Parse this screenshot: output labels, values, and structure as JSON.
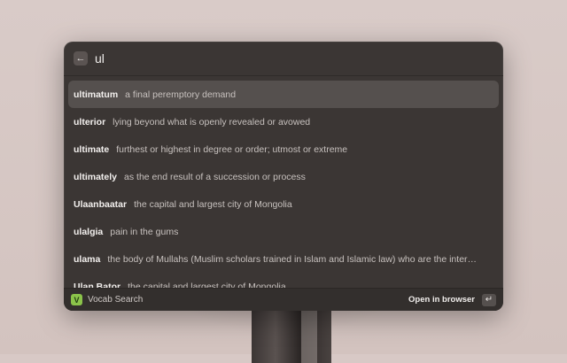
{
  "search": {
    "query": "ul",
    "back_icon": "←"
  },
  "results": [
    {
      "term": "ultimatum",
      "definition": "a final peremptory demand",
      "selected": true
    },
    {
      "term": "ulterior",
      "definition": "lying beyond what is openly revealed or avowed"
    },
    {
      "term": "ultimate",
      "definition": "furthest or highest in degree or order; utmost or extreme"
    },
    {
      "term": "ultimately",
      "definition": "as the end result of a succession or process"
    },
    {
      "term": "Ulaanbaatar",
      "definition": "the capital and largest city of Mongolia"
    },
    {
      "term": "ulalgia",
      "definition": "pain in the gums"
    },
    {
      "term": "ulama",
      "definition": "the body of Mullahs (Muslim scholars trained in Islam and Islamic law) who are the interpret..."
    },
    {
      "term": "Ulan Bator",
      "definition": "the capital and largest city of Mongolia"
    }
  ],
  "footer": {
    "extension_icon": "V",
    "extension_name": "Vocab Search",
    "action_label": "Open in browser",
    "enter_icon": "↵"
  },
  "colors": {
    "extension_accent": "#8bc34a",
    "selected_row": "#55504e",
    "window_bg": "#3b3634"
  }
}
